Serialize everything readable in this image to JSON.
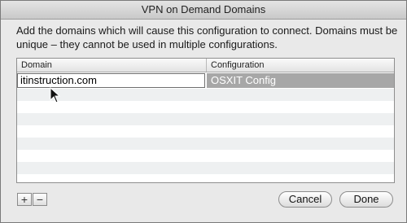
{
  "window": {
    "title": "VPN on Demand Domains"
  },
  "description": "Add the domains which will cause this configuration to connect. Domains must be unique – they cannot be used in multiple configurations.",
  "table": {
    "columns": [
      "Domain",
      "Configuration"
    ],
    "rows": [
      {
        "domain": "itinstruction.com",
        "configuration": "OSXIT Config"
      }
    ]
  },
  "controls": {
    "add_label": "+",
    "remove_label": "−",
    "cancel_label": "Cancel",
    "done_label": "Done"
  },
  "colors": {
    "selected_row": "#a7a7a7",
    "stripe": "#eef0f1"
  }
}
